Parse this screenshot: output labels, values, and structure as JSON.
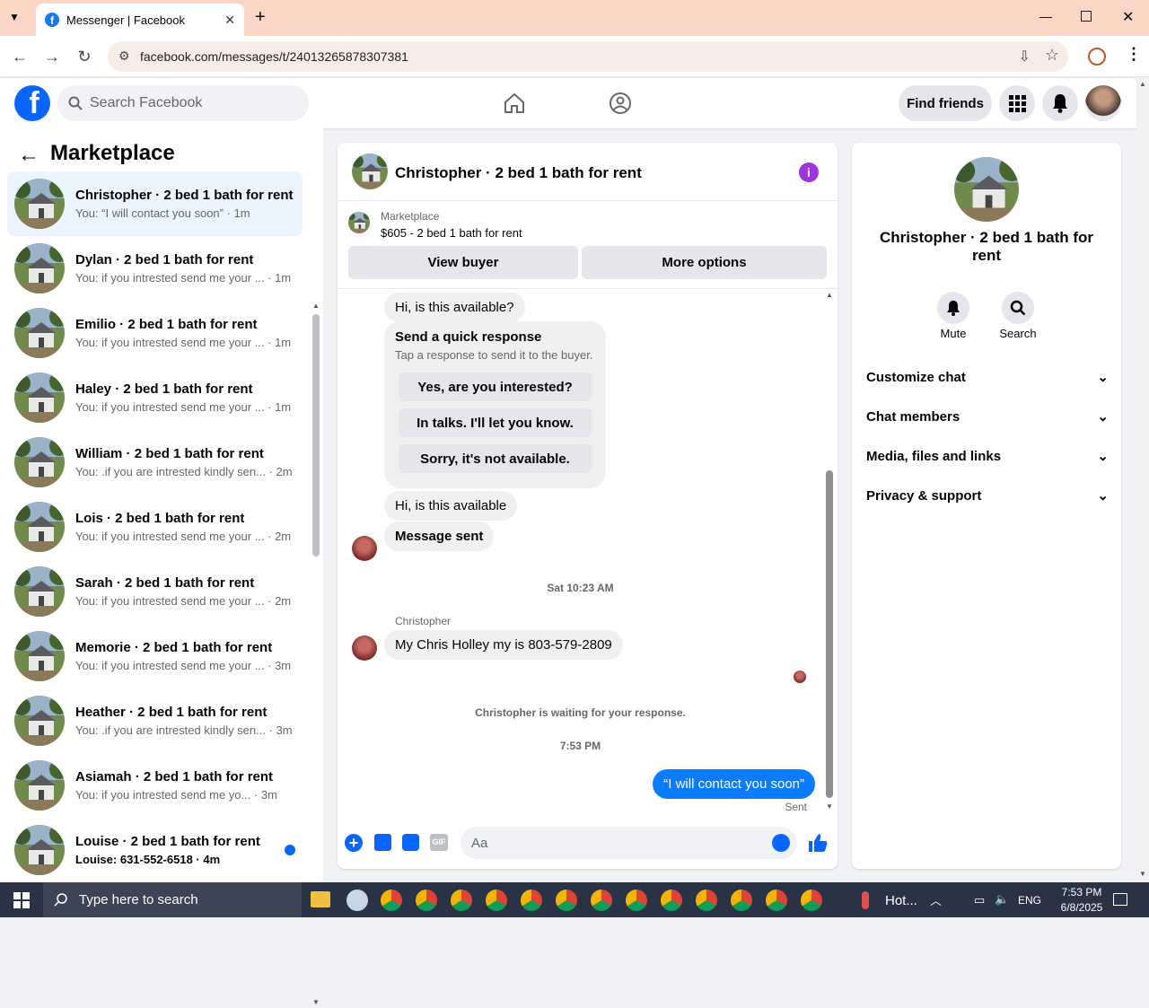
{
  "browser": {
    "tab_title": "Messenger | Facebook",
    "url": "facebook.com/messages/t/24013265878307381"
  },
  "fb": {
    "search_placeholder": "Search Facebook",
    "find_friends": "Find friends"
  },
  "sidebar": {
    "title": "Marketplace",
    "conversations": [
      {
        "name": "Christopher · 2 bed 1 bath for rent",
        "preview": "You: “I will contact you soon” · 1m",
        "active": true
      },
      {
        "name": "Dylan · 2 bed 1 bath for rent",
        "preview": "You: if you intrested send me your ... · 1m"
      },
      {
        "name": "Emilio · 2 bed 1 bath for rent",
        "preview": "You: if you intrested send me your ... · 1m"
      },
      {
        "name": "Haley · 2 bed 1 bath for rent",
        "preview": "You: if you intrested send me your ... · 1m"
      },
      {
        "name": "William · 2 bed 1 bath for rent",
        "preview": "You: .if you are intrested kindly sen... · 2m"
      },
      {
        "name": "Lois · 2 bed 1 bath for rent",
        "preview": "You: if you intrested send me your ... · 2m"
      },
      {
        "name": "Sarah · 2 bed 1 bath for rent",
        "preview": "You: if you intrested send me your ... · 2m"
      },
      {
        "name": "Memorie · 2 bed 1 bath for rent",
        "preview": "You: if you intrested send me your ... · 3m"
      },
      {
        "name": "Heather · 2 bed 1 bath for rent",
        "preview": "You: .if you are intrested kindly sen... · 3m"
      },
      {
        "name": "Asiamah · 2 bed 1 bath for rent",
        "preview": "You: if you intrested send me yo... · 3m"
      },
      {
        "name": "Louise · 2 bed 1 bath for rent",
        "preview": "Louise: 631-552-6518 · 4m",
        "unread": true
      }
    ]
  },
  "chat": {
    "title": "Christopher · 2 bed 1 bath for rent",
    "listing_source": "Marketplace",
    "listing": "$605 - 2 bed 1 bath for rent",
    "view_buyer": "View buyer",
    "more_options": "More options",
    "msg1": "Hi, is this available?",
    "quick_title": "Send a quick response",
    "quick_sub": "Tap a response to send it to the buyer.",
    "quick_replies": [
      "Yes, are you interested?",
      "In talks. I'll let you know.",
      "Sorry, it's not available."
    ],
    "msg2": "Hi, is this available",
    "msg3": "Message sent",
    "timestamp1": "Sat 10:23 AM",
    "sender": "Christopher",
    "msg4": "My Chris Holley my is 803-579-2809",
    "waiting": "Christopher is waiting for your response.",
    "timestamp2": "7:53 PM",
    "my_msg": "“I will contact you soon”",
    "sent": "Sent",
    "input_placeholder": "Aa"
  },
  "details": {
    "name": "Christopher · 2 bed 1 bath for rent",
    "mute": "Mute",
    "search": "Search",
    "sections": [
      "Customize chat",
      "Chat members",
      "Media, files and links",
      "Privacy & support"
    ]
  },
  "taskbar": {
    "search_placeholder": "Type here to search",
    "weather": "Hot...",
    "lang": "ENG",
    "time": "7:53 PM",
    "date": "6/8/2025"
  },
  "colors": {
    "accent": "#0866ff",
    "bubble_out": "#0a7cff",
    "info": "#a033e0"
  }
}
